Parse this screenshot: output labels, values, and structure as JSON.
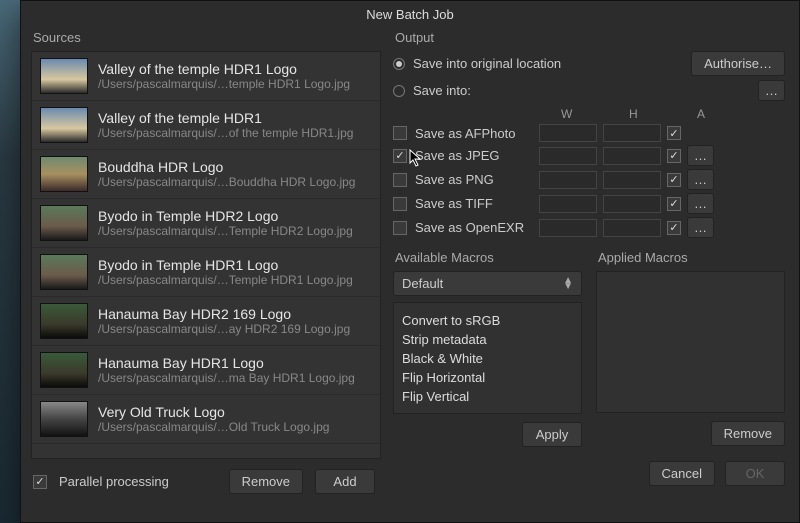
{
  "title": "New Batch Job",
  "left": {
    "section": "Sources",
    "items": [
      {
        "name": "Valley of the temple HDR1 Logo",
        "path": "/Users/pascalmarquis/…temple HDR1 Logo.jpg",
        "thumb": "b1"
      },
      {
        "name": "Valley of the temple HDR1",
        "path": "/Users/pascalmarquis/…of the temple HDR1.jpg",
        "thumb": "b1"
      },
      {
        "name": "Bouddha HDR Logo",
        "path": "/Users/pascalmarquis/…Bouddha HDR Logo.jpg",
        "thumb": "b2"
      },
      {
        "name": "Byodo in Temple HDR2 Logo",
        "path": "/Users/pascalmarquis/…Temple HDR2 Logo.jpg",
        "thumb": "b3"
      },
      {
        "name": "Byodo in Temple HDR1 Logo",
        "path": "/Users/pascalmarquis/…Temple HDR1 Logo.jpg",
        "thumb": "b3"
      },
      {
        "name": "Hanauma Bay HDR2 169 Logo",
        "path": "/Users/pascalmarquis/…ay HDR2 169 Logo.jpg",
        "thumb": "b4"
      },
      {
        "name": "Hanauma Bay HDR1 Logo",
        "path": "/Users/pascalmarquis/…ma Bay HDR1 Logo.jpg",
        "thumb": "b4"
      },
      {
        "name": "Very Old Truck Logo",
        "path": "/Users/pascalmarquis/…Old Truck Logo.jpg",
        "thumb": "b5"
      }
    ],
    "parallel_label": "Parallel processing",
    "parallel_checked": true,
    "remove_btn": "Remove",
    "add_btn": "Add"
  },
  "right": {
    "section": "Output",
    "save_original": "Save into original location",
    "save_into": "Save into:",
    "save_original_selected": true,
    "authorise": "Authorise…",
    "browse": "…",
    "col_w": "W",
    "col_h": "H",
    "col_a": "A",
    "formats": [
      {
        "label": "Save as AFPhoto",
        "checked": false,
        "a": true,
        "opts": false
      },
      {
        "label": "Save as JPEG",
        "checked": true,
        "a": true,
        "opts": true
      },
      {
        "label": "Save as PNG",
        "checked": false,
        "a": true,
        "opts": true
      },
      {
        "label": "Save as TIFF",
        "checked": false,
        "a": true,
        "opts": true
      },
      {
        "label": "Save as OpenEXR",
        "checked": false,
        "a": true,
        "opts": true
      }
    ],
    "available_label": "Available Macros",
    "applied_label": "Applied Macros",
    "macro_select": "Default",
    "macros": [
      "Convert to sRGB",
      "Strip metadata",
      "Black & White",
      "Flip Horizontal",
      "Flip Vertical"
    ],
    "apply_btn": "Apply",
    "remove_btn": "Remove",
    "cancel_btn": "Cancel",
    "ok_btn": "OK"
  }
}
